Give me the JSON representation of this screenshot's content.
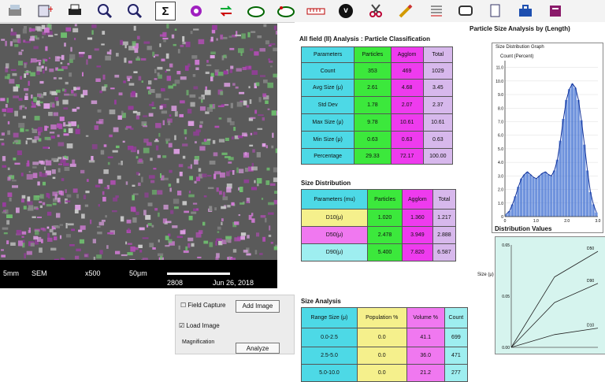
{
  "toolbar": {
    "icons": [
      "scanner-icon",
      "add-image-icon",
      "print-icon",
      "zoom-in-icon",
      "zoom-out-icon",
      "sigma-icon",
      "settings-gear-icon",
      "swap-icon",
      "software-icon",
      "software-2-icon",
      "ruler-icon",
      "v-icon",
      "scissors-icon",
      "pencil-icon",
      "sort-icon",
      "screen-icon",
      "document-icon",
      "toolbox-icon",
      "book-icon"
    ],
    "sigma_label": "Σ",
    "v_label": "v"
  },
  "viewer": {
    "info": {
      "scale_left": "5mm",
      "voltage": "SEM",
      "mag": "x500",
      "bar_label": "50μm",
      "code": "2808",
      "date": "Jun 26, 2018"
    }
  },
  "controls": {
    "field_capture": "Field Capture",
    "load_image": "Load Image",
    "add_image": "Add Image",
    "analyze": "Analyze",
    "magnification": "Magnification"
  },
  "panel": {
    "title": "Particle Size Analysis by (Length)",
    "section1": "All field (II) Analysis : Particle Classification",
    "section2": "Size Distribution",
    "section3": "Size Analysis",
    "section4": "Distribution Values",
    "table1": {
      "headers": [
        "Parameters",
        "Particles",
        "Agglom",
        "Total"
      ],
      "rows": [
        [
          "Count",
          "353",
          "469",
          "1029"
        ],
        [
          "Avg Size (μ)",
          "2.61",
          "4.68",
          "3.45"
        ],
        [
          "Std Dev",
          "1.78",
          "2.07",
          "2.37"
        ],
        [
          "Max Size (μ)",
          "9.78",
          "10.61",
          "10.61"
        ],
        [
          "Min Size (μ)",
          "0.63",
          "0.63",
          "0.63"
        ],
        [
          "Percentage",
          "29.33",
          "72.17",
          "100.00"
        ]
      ]
    },
    "table2": {
      "headers": [
        "Parameters (mu)",
        "Particles",
        "Agglom",
        "Total"
      ],
      "rows": [
        [
          "D10(μ)",
          "1.020",
          "1.360",
          "1.217"
        ],
        [
          "D50(μ)",
          "2.478",
          "3.949",
          "2.888"
        ],
        [
          "D90(μ)",
          "5.400",
          "7.820",
          "6.587"
        ]
      ]
    },
    "table3": {
      "headers": [
        "Range Size (μ)",
        "Population %",
        "Volume %",
        "Count"
      ],
      "rows": [
        [
          "0.0-2.5",
          "0.0",
          "41.1",
          "699"
        ],
        [
          "2.5-5.0",
          "0.0",
          "36.0",
          "471"
        ],
        [
          "5.0-10.0",
          "0.0",
          "21.2",
          "277"
        ]
      ]
    },
    "chart1_title": "Size Distribution Graph",
    "chart1_ylabel": "Count (Percent)",
    "chart2_ylabel": "Size (μ)",
    "chart2_labels": [
      "0.65",
      "0.05",
      "D50",
      "D90",
      "D10"
    ]
  },
  "chart_data": [
    {
      "type": "bar",
      "title": "Size Distribution Graph",
      "ylabel": "Count (Percent)",
      "xlabel": "",
      "x_ticks": [
        "0",
        "1.0",
        "2.0",
        "3.0"
      ],
      "y_ticks": [
        "0",
        "1.0",
        "2.0",
        "3.0",
        "4.0",
        "5.0",
        "6.0",
        "7.0",
        "8.0",
        "9.0",
        "10.0",
        "11.0"
      ],
      "ylim": [
        0,
        11.5
      ],
      "values": [
        0.2,
        0.4,
        0.9,
        1.5,
        2.2,
        2.8,
        3.1,
        3.3,
        3.1,
        2.9,
        2.8,
        3.0,
        3.2,
        3.3,
        3.1,
        3.0,
        3.4,
        4.2,
        5.6,
        7.2,
        8.6,
        9.4,
        9.8,
        9.5,
        8.6,
        7.1,
        5.3,
        3.4,
        1.8,
        0.9,
        0.3
      ],
      "grid": true
    },
    {
      "type": "line",
      "ylabel": "Size (μ)",
      "y_ticks": [
        "0.65",
        "0.05",
        "0.00"
      ],
      "series": [
        {
          "name": "D50",
          "values": [
            0.0,
            0.55,
            0.75
          ]
        },
        {
          "name": "D90",
          "values": [
            0.0,
            0.35,
            0.5
          ]
        },
        {
          "name": "D10",
          "values": [
            0.0,
            0.1,
            0.15
          ]
        }
      ]
    }
  ]
}
